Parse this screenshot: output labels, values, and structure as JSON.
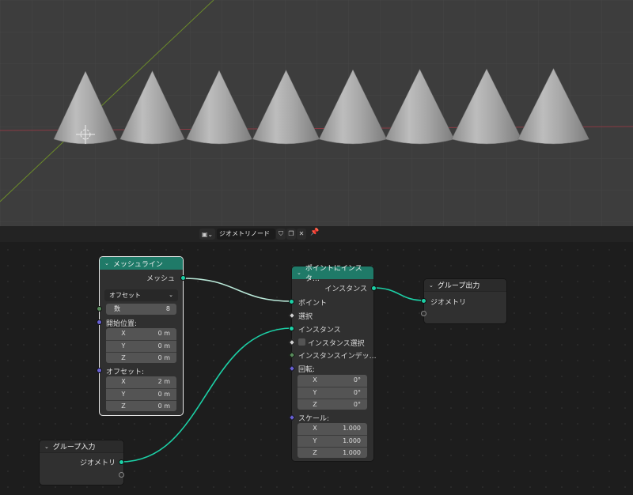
{
  "header": {
    "node_type_icon": "geometry-nodes-icon",
    "tree_name": "ジオメトリノード",
    "fake_user_icon": "shield-icon",
    "duplicate_icon": "duplicate-icon",
    "unlink_icon": "close-icon",
    "pin_icon": "pin-icon"
  },
  "viewport": {
    "cone_count": 8,
    "bg_color": "#3d3d3d",
    "x_axis_color": "#8a3a44",
    "y_axis_color": "#6b8a2a"
  },
  "nodes": {
    "mesh_line": {
      "title": "メッシュライン",
      "out_mesh": "メッシュ",
      "mode": "オフセット",
      "count_label": "数",
      "count_value": "8",
      "start_label": "開始位置:",
      "start": [
        {
          "axis": "X",
          "value": "0 m"
        },
        {
          "axis": "Y",
          "value": "0 m"
        },
        {
          "axis": "Z",
          "value": "0 m"
        }
      ],
      "offset_label": "オフセット:",
      "offset": [
        {
          "axis": "X",
          "value": "2 m"
        },
        {
          "axis": "Y",
          "value": "0 m"
        },
        {
          "axis": "Z",
          "value": "0 m"
        }
      ]
    },
    "instance_on_points": {
      "title": "ポイントにインスタ…",
      "out_instances": "インスタンス",
      "in_points": "ポイント",
      "in_selection": "選択",
      "in_instance": "インスタンス",
      "in_pick_instance": "インスタンス選択",
      "in_instance_index": "インスタンスインデッ…",
      "rotation_label": "回転:",
      "rotation": [
        {
          "axis": "X",
          "value": "0°"
        },
        {
          "axis": "Y",
          "value": "0°"
        },
        {
          "axis": "Z",
          "value": "0°"
        }
      ],
      "scale_label": "スケール:",
      "scale": [
        {
          "axis": "X",
          "value": "1.000"
        },
        {
          "axis": "Y",
          "value": "1.000"
        },
        {
          "axis": "Z",
          "value": "1.000"
        }
      ]
    },
    "group_output": {
      "title": "グループ出力",
      "in_geometry": "ジオメトリ"
    },
    "group_input": {
      "title": "グループ入力",
      "out_geometry": "ジオメトリ"
    }
  },
  "colors": {
    "geometry_socket": "#1cd0a6",
    "vector_socket": "#6760d3",
    "integer_socket": "#598c5c",
    "geometry_header": "#1f7a68"
  }
}
